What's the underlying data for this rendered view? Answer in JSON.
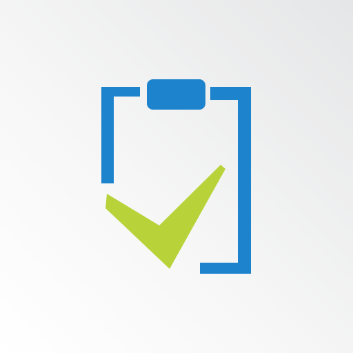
{
  "icon": {
    "name": "clipboard-check-icon",
    "colors": {
      "clipboard": "#1c83cc",
      "checkmark": "#b8d33a",
      "background_light": "#ffffff",
      "background_dark": "#e5e6e7"
    }
  }
}
